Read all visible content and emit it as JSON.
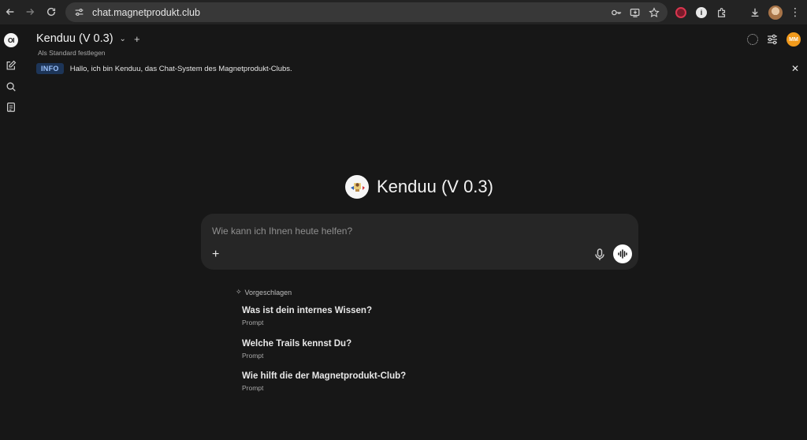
{
  "browser": {
    "url": "chat.magnetprodukt.club"
  },
  "sidebar": {
    "logo_text": "OI",
    "icons": [
      "new-chat-icon",
      "search-icon",
      "notes-icon"
    ]
  },
  "header": {
    "model_name": "Kenduu (V 0.3)",
    "set_default": "Als Standard festlegen",
    "user_initials": "MM"
  },
  "banner": {
    "badge": "INFO",
    "text": "Hallo, ich bin Kenduu, das Chat-System des Magnetprodukt-Clubs."
  },
  "main": {
    "title": "Kenduu (V 0.3)",
    "input_placeholder": "Wie kann ich Ihnen heute helfen?"
  },
  "suggestions": {
    "header": "Vorgeschlagen",
    "items": [
      {
        "title": "Was ist dein internes Wissen?",
        "subtitle": "Prompt"
      },
      {
        "title": "Welche Trails kennst Du?",
        "subtitle": "Prompt"
      },
      {
        "title": "Wie hilft die der Magnetprodukt-Club?",
        "subtitle": "Prompt"
      }
    ]
  },
  "colors": {
    "background": "#171717",
    "chat_box": "#262626",
    "info_badge_bg": "#1d3558",
    "info_badge_text": "#9cc3ff",
    "avatar": "#f19a1c"
  }
}
